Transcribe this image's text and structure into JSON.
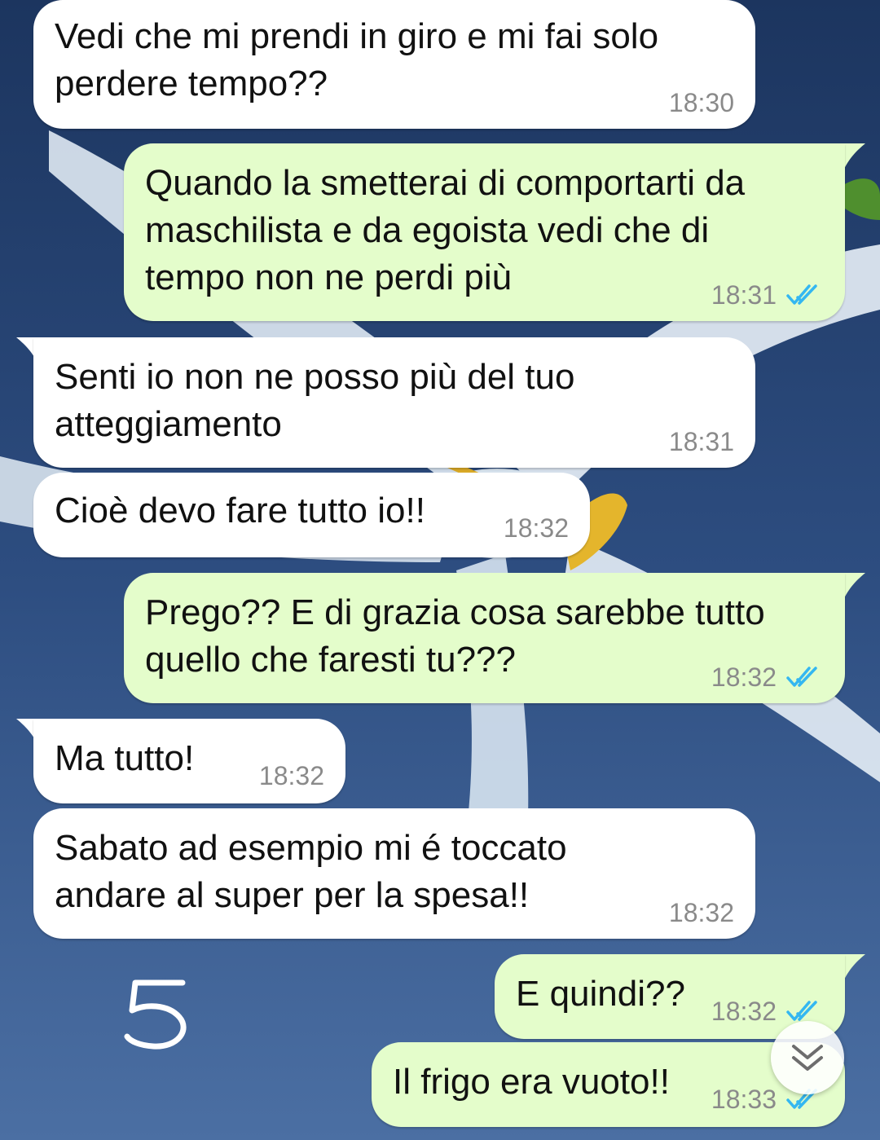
{
  "theme": {
    "incoming_bubble": "#ffffff",
    "outgoing_bubble": "#e4fdcb",
    "read_tick_color": "#34b7f1",
    "timestamp_color": "#8a8a8a"
  },
  "messages": [
    {
      "direction": "incoming",
      "text": "Vedi che mi prendi in giro e mi fai solo\nperdere tempo??",
      "time": "18:30"
    },
    {
      "direction": "outgoing",
      "text": "Quando la smetterai di comportarti da\nmaschilista e da egoista vedi che di\ntempo non ne perdi più",
      "time": "18:31",
      "status_icon": "double-check-read-icon"
    },
    {
      "direction": "incoming",
      "text": "Senti io non ne posso più del tuo\natteggiamento",
      "time": "18:31"
    },
    {
      "direction": "incoming",
      "text": "Cioè devo fare tutto io!!",
      "time": "18:32"
    },
    {
      "direction": "outgoing",
      "text": "Prego?? E di grazia cosa sarebbe tutto\nquello che faresti tu???",
      "time": "18:32",
      "status_icon": "double-check-read-icon"
    },
    {
      "direction": "incoming",
      "text": "Ma tutto!",
      "time": "18:32"
    },
    {
      "direction": "incoming",
      "text": "Sabato ad esempio mi é toccato\nandare al super per la spesa!!",
      "time": "18:32"
    },
    {
      "direction": "outgoing",
      "text": "E quindi??",
      "time": "18:32",
      "status_icon": "double-check-read-icon"
    },
    {
      "direction": "outgoing",
      "text": "Il frigo era vuoto!!",
      "time": "18:33",
      "status_icon": "double-check-read-icon"
    }
  ],
  "handwritten_mark": "5",
  "scroll_button_icon": "double-chevron-down-icon"
}
